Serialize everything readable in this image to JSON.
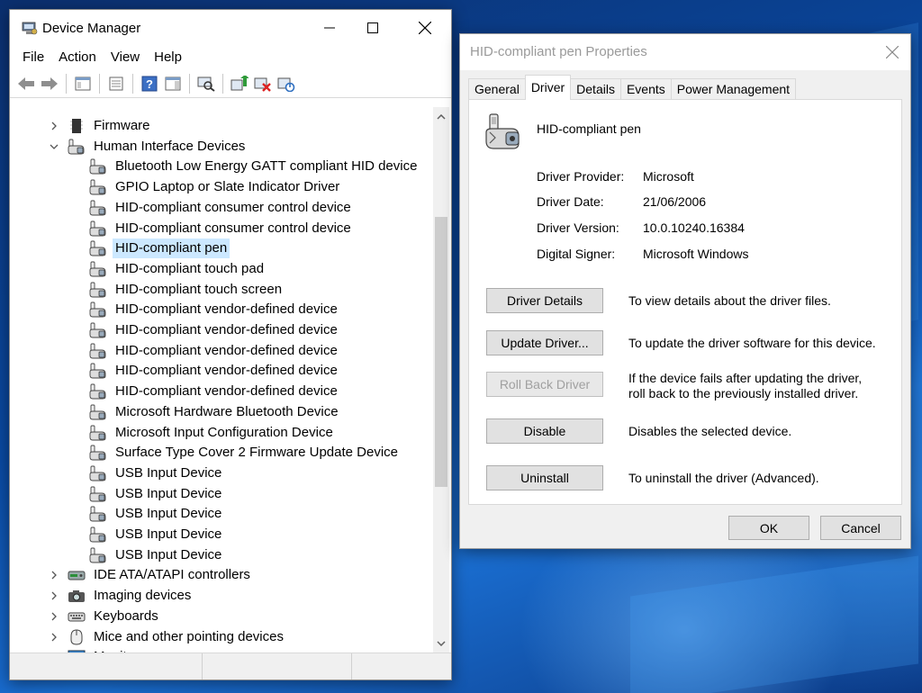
{
  "device_manager": {
    "title": "Device Manager",
    "menu": [
      "File",
      "Action",
      "View",
      "Help"
    ],
    "tree": [
      {
        "label": "Firmware",
        "expander": "collapsed",
        "indent": 0,
        "icon": "firmware-icon"
      },
      {
        "label": "Human Interface Devices",
        "expander": "expanded",
        "indent": 0,
        "icon": "hid-icon"
      },
      {
        "label": "Bluetooth Low Energy GATT compliant HID device",
        "indent": 1,
        "icon": "hid-icon"
      },
      {
        "label": "GPIO Laptop or Slate Indicator Driver",
        "indent": 1,
        "icon": "hid-icon"
      },
      {
        "label": "HID-compliant consumer control device",
        "indent": 1,
        "icon": "hid-icon"
      },
      {
        "label": "HID-compliant consumer control device",
        "indent": 1,
        "icon": "hid-icon"
      },
      {
        "label": "HID-compliant pen",
        "indent": 1,
        "icon": "hid-icon",
        "selected": true
      },
      {
        "label": "HID-compliant touch pad",
        "indent": 1,
        "icon": "hid-icon"
      },
      {
        "label": "HID-compliant touch screen",
        "indent": 1,
        "icon": "hid-icon"
      },
      {
        "label": "HID-compliant vendor-defined device",
        "indent": 1,
        "icon": "hid-icon"
      },
      {
        "label": "HID-compliant vendor-defined device",
        "indent": 1,
        "icon": "hid-icon"
      },
      {
        "label": "HID-compliant vendor-defined device",
        "indent": 1,
        "icon": "hid-icon"
      },
      {
        "label": "HID-compliant vendor-defined device",
        "indent": 1,
        "icon": "hid-icon"
      },
      {
        "label": "HID-compliant vendor-defined device",
        "indent": 1,
        "icon": "hid-icon"
      },
      {
        "label": "Microsoft Hardware Bluetooth Device",
        "indent": 1,
        "icon": "hid-icon"
      },
      {
        "label": "Microsoft Input Configuration Device",
        "indent": 1,
        "icon": "hid-icon"
      },
      {
        "label": "Surface Type Cover 2 Firmware Update Device",
        "indent": 1,
        "icon": "hid-icon"
      },
      {
        "label": "USB Input Device",
        "indent": 1,
        "icon": "hid-icon"
      },
      {
        "label": "USB Input Device",
        "indent": 1,
        "icon": "hid-icon"
      },
      {
        "label": "USB Input Device",
        "indent": 1,
        "icon": "hid-icon"
      },
      {
        "label": "USB Input Device",
        "indent": 1,
        "icon": "hid-icon"
      },
      {
        "label": "USB Input Device",
        "indent": 1,
        "icon": "hid-icon"
      },
      {
        "label": "IDE ATA/ATAPI controllers",
        "expander": "collapsed",
        "indent": 0,
        "icon": "ide-icon"
      },
      {
        "label": "Imaging devices",
        "expander": "collapsed",
        "indent": 0,
        "icon": "camera-icon"
      },
      {
        "label": "Keyboards",
        "expander": "collapsed",
        "indent": 0,
        "icon": "keyboard-icon"
      },
      {
        "label": "Mice and other pointing devices",
        "expander": "collapsed",
        "indent": 0,
        "icon": "mouse-icon"
      },
      {
        "label": "Monitors",
        "expander": "collapsed",
        "indent": 0,
        "icon": "monitor-icon"
      }
    ]
  },
  "properties": {
    "title": "HID-compliant pen Properties",
    "tabs": [
      "General",
      "Driver",
      "Details",
      "Events",
      "Power Management"
    ],
    "active_tab": "Driver",
    "device_name": "HID-compliant pen",
    "info": [
      {
        "label": "Driver Provider:",
        "value": "Microsoft"
      },
      {
        "label": "Driver Date:",
        "value": "21/06/2006"
      },
      {
        "label": "Driver Version:",
        "value": "10.0.10240.16384"
      },
      {
        "label": "Digital Signer:",
        "value": "Microsoft Windows"
      }
    ],
    "actions": [
      {
        "label": "Driver Details",
        "desc": "To view details about the driver files.",
        "enabled": true
      },
      {
        "label": "Update Driver...",
        "desc": "To update the driver software for this device.",
        "enabled": true
      },
      {
        "label": "Roll Back Driver",
        "desc": "If the device fails after updating the driver, roll back to the previously installed driver.",
        "enabled": false
      },
      {
        "label": "Disable",
        "desc": "Disables the selected device.",
        "enabled": true
      },
      {
        "label": "Uninstall",
        "desc": "To uninstall the driver (Advanced).",
        "enabled": true
      }
    ],
    "ok_label": "OK",
    "cancel_label": "Cancel"
  },
  "colors": {
    "selection": "#cce8ff",
    "desktop": "#0a4aa3"
  }
}
